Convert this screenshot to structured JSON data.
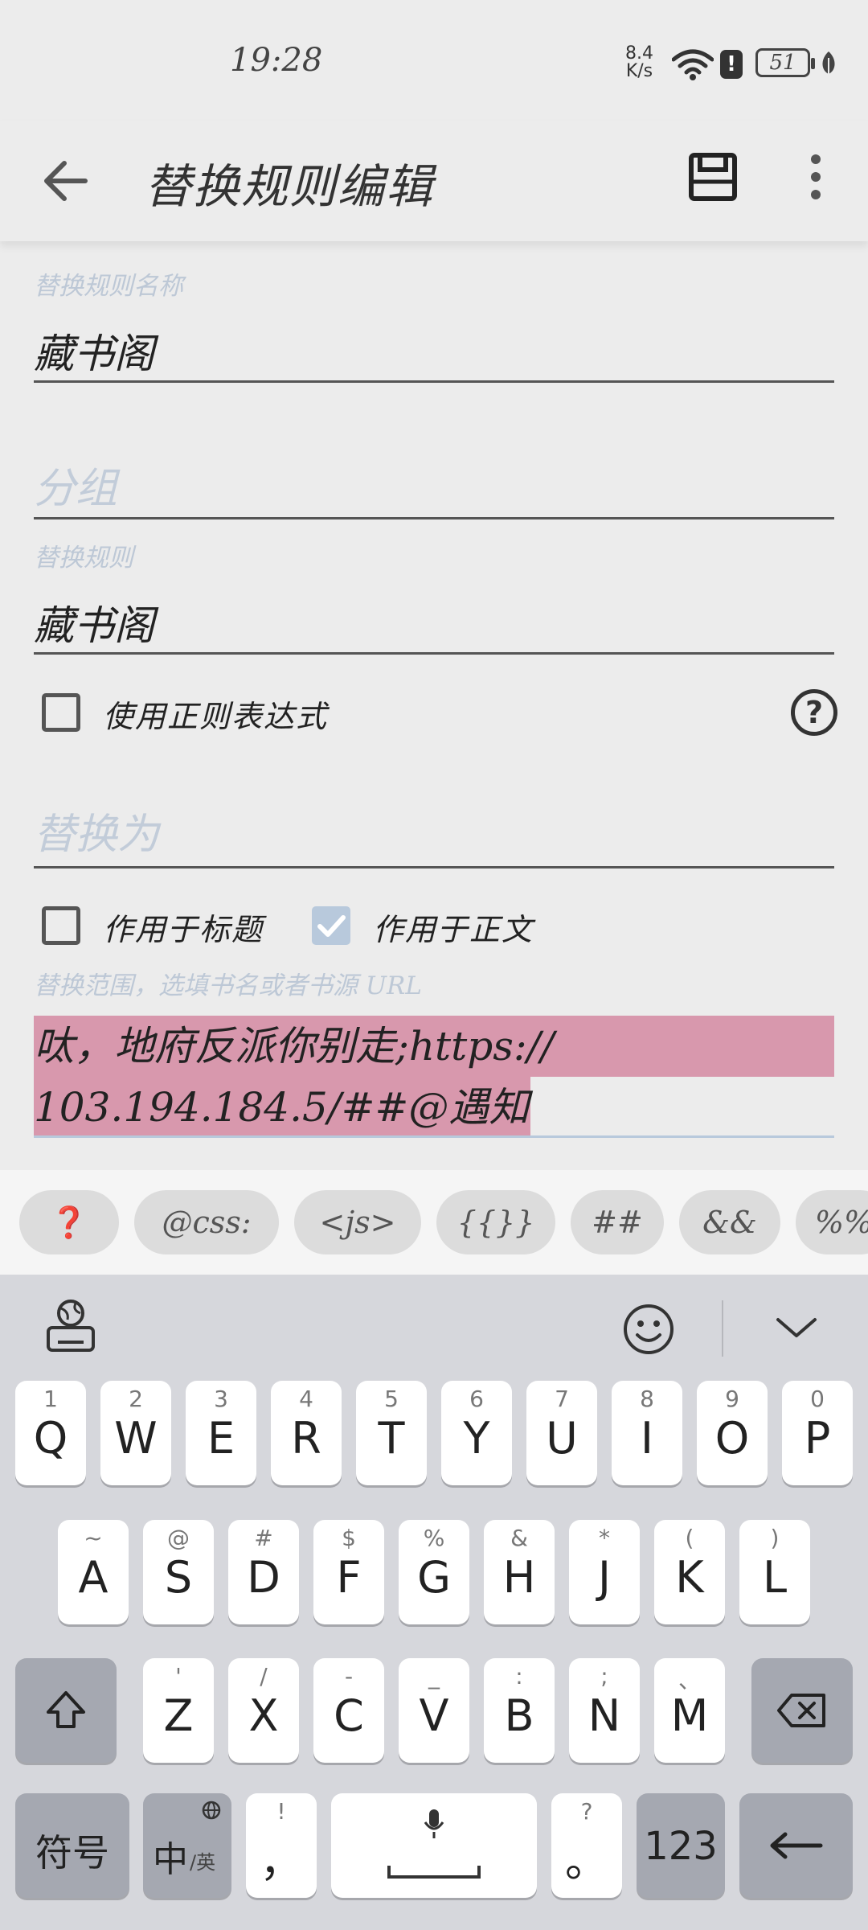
{
  "status": {
    "time": "19:28",
    "net_speed_value": "8.4",
    "net_speed_unit": "K/s",
    "battery": "51"
  },
  "toolbar": {
    "title": "替换规则编辑"
  },
  "form": {
    "name_label": "替换规则名称",
    "name_value": "藏书阁",
    "group_placeholder": "分组",
    "rule_label": "替换规则",
    "rule_value": "藏书阁",
    "use_regex_label": "使用正则表达式",
    "replace_placeholder": "替换为",
    "apply_title_label": "作用于标题",
    "apply_content_label": "作用于正文",
    "scope_label": "替换范围，选填书名或者书源 URL",
    "scope_value_line1": "呔，地府反派你别走;https://",
    "scope_value_line2": "103.194.184.5/##@遇知"
  },
  "checkboxes": {
    "use_regex": false,
    "apply_title": false,
    "apply_content": true
  },
  "chips": [
    "❓",
    "@css:",
    "<js>",
    "{{}}",
    "##",
    "&&",
    "%%"
  ],
  "keyboard": {
    "row1": [
      {
        "hint": "1",
        "key": "Q"
      },
      {
        "hint": "2",
        "key": "W"
      },
      {
        "hint": "3",
        "key": "E"
      },
      {
        "hint": "4",
        "key": "R"
      },
      {
        "hint": "5",
        "key": "T"
      },
      {
        "hint": "6",
        "key": "Y"
      },
      {
        "hint": "7",
        "key": "U"
      },
      {
        "hint": "8",
        "key": "I"
      },
      {
        "hint": "9",
        "key": "O"
      },
      {
        "hint": "0",
        "key": "P"
      }
    ],
    "row2": [
      {
        "hint": "~",
        "key": "A"
      },
      {
        "hint": "@",
        "key": "S"
      },
      {
        "hint": "#",
        "key": "D"
      },
      {
        "hint": "$",
        "key": "F"
      },
      {
        "hint": "%",
        "key": "G"
      },
      {
        "hint": "&",
        "key": "H"
      },
      {
        "hint": "*",
        "key": "J"
      },
      {
        "hint": "(",
        "key": "K"
      },
      {
        "hint": ")",
        "key": "L"
      }
    ],
    "row3": [
      {
        "hint": "'",
        "key": "Z"
      },
      {
        "hint": "/",
        "key": "X"
      },
      {
        "hint": "-",
        "key": "C"
      },
      {
        "hint": "_",
        "key": "V"
      },
      {
        "hint": ":",
        "key": "B"
      },
      {
        "hint": ";",
        "key": "N"
      },
      {
        "hint": "、",
        "key": "M"
      }
    ],
    "symbols_label": "符号",
    "lang_main": "中",
    "lang_sub": "/英",
    "comma_hint": "!",
    "comma": "，",
    "period_hint": "?",
    "period": "。",
    "num_label": "123"
  },
  "colors": {
    "selection": "#d898ad",
    "checked": "#b8c9dc",
    "accent_help": "#e03040"
  }
}
